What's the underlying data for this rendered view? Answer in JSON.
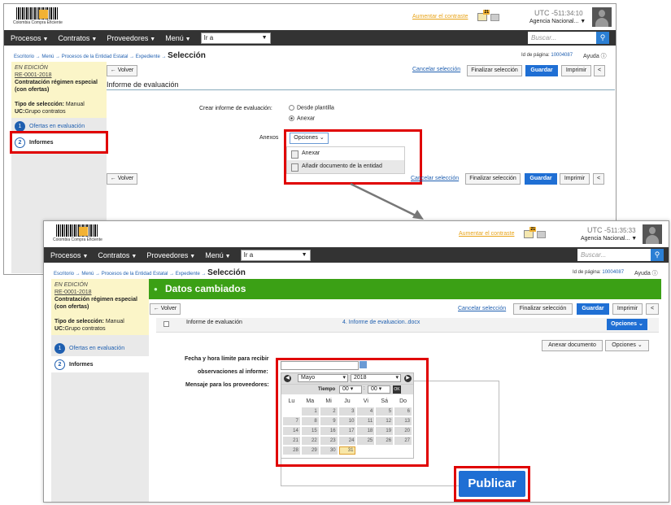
{
  "logo_text": "Colombia Compra Eficiente",
  "contract_link": "Aumentar el contraste",
  "notif_count": "21",
  "nav": {
    "items": [
      "Procesos",
      "Contratos",
      "Proveedores",
      "Menú"
    ],
    "goto": "Ir a",
    "search_placeholder": "Buscar..."
  },
  "user": {
    "agency": "Agencia Nacional..."
  },
  "breadcrumb": {
    "items": [
      "Escritorio",
      "Menú",
      "Procesos de la Entidad Estatal",
      "Expediente"
    ],
    "current": "Selección"
  },
  "page_id_label": "Id de página:",
  "page_id": "10004087",
  "help": "Ayuda",
  "sidebar": {
    "status": "EN EDICIÓN",
    "ref": "RE-0001-2018",
    "type": "Contratación régimen especial (con ofertas)",
    "sel_label": "Tipo de selección:",
    "sel_value": "Manual",
    "uc_label": "UC:",
    "uc_value": "Grupo contratos",
    "steps": [
      {
        "n": "1",
        "label": "Ofertas en evaluación"
      },
      {
        "n": "2",
        "label": "Informes"
      }
    ]
  },
  "actions": {
    "back": "Volver",
    "cancel": "Cancelar selección",
    "finish": "Finalizar selección",
    "save": "Guardar",
    "print": "Imprimir",
    "collapse": "<"
  },
  "screen1": {
    "utc": "UTC -5",
    "time": "11:34:10",
    "section_title": "Informe de evaluación",
    "create_label": "Crear informe de evaluación:",
    "opt_template": "Desde plantilla",
    "opt_attach": "Anexar",
    "annex_label": "Anexos",
    "options_btn": "Opciones",
    "dropdown": [
      "Anexar",
      "Añadir documento de la entidad"
    ]
  },
  "screen2": {
    "utc": "UTC -5",
    "time": "11:35:33",
    "banner": "Datos cambiados",
    "report_label": "Informe de evaluación",
    "report_file": "4. Informe de evaluacion..docx",
    "options_btn": "Opciones",
    "annex_doc": "Anexar documento",
    "deadline_label_1": "Fecha y hora límite para recibir",
    "deadline_label_2": "observaciones al informe:",
    "message_label": "Mensaje para los proveedores:",
    "publish": "Publicar"
  },
  "calendar": {
    "month": "Mayo",
    "year": "2018",
    "time_label": "Tiempo",
    "hour": "00",
    "minute": "00",
    "weekdays": [
      "Lu",
      "Ma",
      "Mi",
      "Ju",
      "Vi",
      "Sá",
      "Do"
    ],
    "weeks": [
      [
        "",
        "1",
        "2",
        "3",
        "4",
        "5",
        "6"
      ],
      [
        "7",
        "8",
        "9",
        "10",
        "11",
        "12",
        "13"
      ],
      [
        "14",
        "15",
        "16",
        "17",
        "18",
        "19",
        "20"
      ],
      [
        "21",
        "22",
        "23",
        "24",
        "25",
        "26",
        "27"
      ],
      [
        "28",
        "29",
        "30",
        "31",
        "",
        "",
        ""
      ]
    ],
    "today": "31"
  },
  "colors": {
    "nav_bg": "#333333",
    "accent_blue": "#1f6fd4",
    "highlight_red": "#e00000",
    "success_green": "#3ba015",
    "sidebar_yellow": "#fbf5c8"
  }
}
